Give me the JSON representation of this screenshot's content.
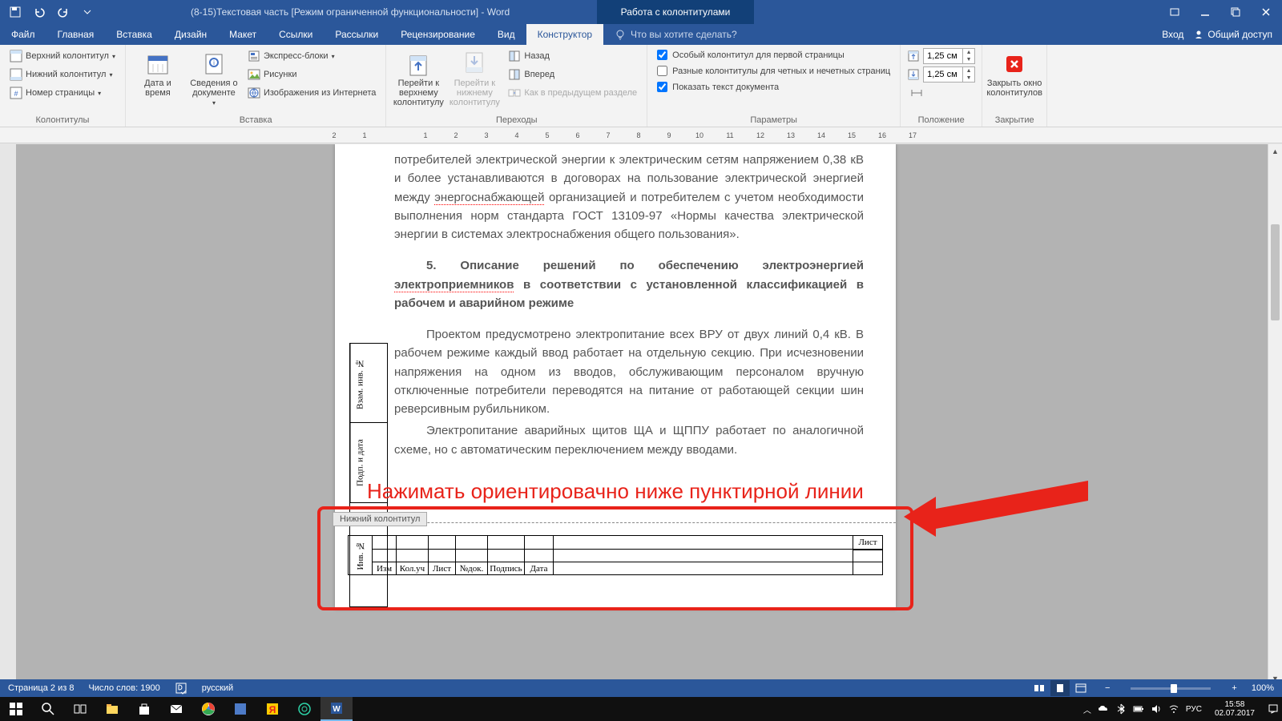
{
  "titlebar": {
    "doc_title": "(8-15)Текстовая часть [Режим ограниченной функциональности] - Word",
    "context_title": "Работа с колонтитулами"
  },
  "tabs": {
    "file": "Файл",
    "home": "Главная",
    "insert": "Вставка",
    "design": "Дизайн",
    "layout": "Макет",
    "references": "Ссылки",
    "mailings": "Рассылки",
    "review": "Рецензирование",
    "view": "Вид",
    "constructor": "Конструктор",
    "tellme": "Что вы хотите сделать?",
    "signin": "Вход",
    "share": "Общий доступ"
  },
  "ribbon": {
    "g_hf": {
      "header": "Верхний колонтитул",
      "footer": "Нижний колонтитул",
      "pagenum": "Номер страницы",
      "label": "Колонтитулы"
    },
    "g_insert": {
      "datetime": "Дата и время",
      "docinfo": "Сведения о документе",
      "quickparts": "Экспресс-блоки",
      "pictures": "Рисунки",
      "online_pics": "Изображения из Интернета",
      "label": "Вставка"
    },
    "g_nav": {
      "goto_header": "Перейти к верхнему колонтитулу",
      "goto_footer": "Перейти к нижнему колонтитулу",
      "back": "Назад",
      "forward": "Вперед",
      "prev_section": "Как в предыдущем разделе",
      "label": "Переходы"
    },
    "g_opts": {
      "first_page": "Особый колонтитул для первой страницы",
      "odd_even": "Разные колонтитулы для четных и нечетных страниц",
      "show_doc": "Показать текст документа",
      "label": "Параметры"
    },
    "g_pos": {
      "top_val": "1,25 см",
      "bot_val": "1,25 см",
      "label": "Положение"
    },
    "g_close": {
      "close": "Закрыть окно колонтитулов",
      "label": "Закрытие"
    }
  },
  "document": {
    "p1": "потребителей электрической энергии к электрическим сетям напряжением 0,38 кВ и более устанавливаются в договорах на пользование электрической энергией между ",
    "p1_sq": "энергоснабжающей",
    "p1b": " организацией и потребителем с учетом необходимости выполнения норм стандарта ГОСТ 13109-97 «Нормы качества электрической энергии в системах электроснабжения общего пользования».",
    "h5a": "5. Описание решений по обеспечению электроэнергией ",
    "h5_sq": "электроприемников",
    "h5b": " в соответствии с установленной классификацией в рабочем и аварийном режиме",
    "p2": "Проектом предусмотрено электропитание всех ВРУ от двух линий 0,4 кВ. В рабочем режиме каждый ввод работает на отдельную секцию. При исчезновении напряжения на одном из вводов, обслуживающим персоналом вручную отключенные потребители переводятся на питание от работающей секции шин реверсивным рубильником.",
    "p3": "Электропитание аварийных щитов ЩА и ЩППУ работает по аналогичной схеме, но с автоматическим переключением между вводами.",
    "side1": "Взам. инв. №",
    "side2": "Подп. и дата",
    "side3": "Инв. №",
    "footer_label": "Нижний колонтитул",
    "stamp": {
      "izm": "Изм",
      "kol": "Кол.уч",
      "list": "Лист",
      "ndok": "№док.",
      "podpis": "Подпись",
      "data": "Дата",
      "list_right": "Лист"
    }
  },
  "annotation": {
    "text": "Нажимать ориентировачно ниже пунктирной линии"
  },
  "status": {
    "page": "Страница 2 из 8",
    "words": "Число слов: 1900",
    "lang": "русский",
    "zoom": "100%"
  },
  "taskbar": {
    "lang": "РУС",
    "time": "15:58",
    "date": "02.07.2017"
  }
}
